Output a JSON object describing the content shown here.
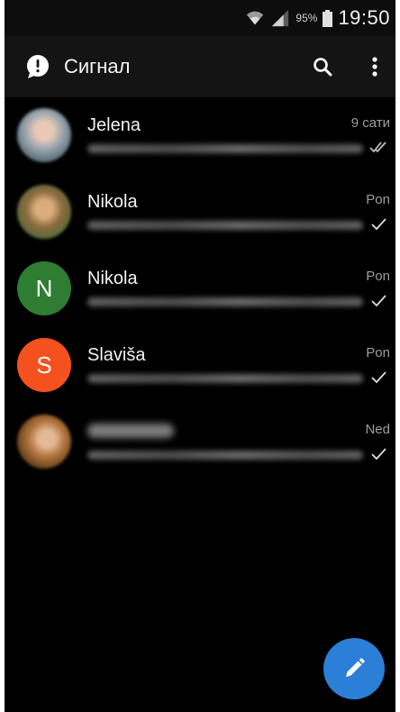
{
  "status_bar": {
    "battery_percent": "95%",
    "time": "19:50"
  },
  "app_bar": {
    "title": "Сигнал",
    "logo_icon": "signal-logo-icon",
    "search_icon": "search-icon",
    "menu_icon": "overflow-menu-icon"
  },
  "conversations": [
    {
      "name": "Jelena",
      "time": "9 сати",
      "avatar": "photo",
      "receipt": "double-check-icon"
    },
    {
      "name": "Nikola",
      "time": "Pon",
      "avatar": "photo",
      "receipt": "check-icon"
    },
    {
      "name": "Nikola",
      "time": "Pon",
      "avatar": "N",
      "avatar_color": "#2e7d32",
      "receipt": "check-icon"
    },
    {
      "name": "Slaviša",
      "time": "Pon",
      "avatar": "S",
      "avatar_color": "#f4511e",
      "receipt": "check-icon"
    },
    {
      "name": "",
      "time": "Ned",
      "avatar": "photo",
      "receipt": "check-icon"
    }
  ],
  "fab": {
    "icon": "pencil-icon",
    "color": "#2b7fd6"
  }
}
